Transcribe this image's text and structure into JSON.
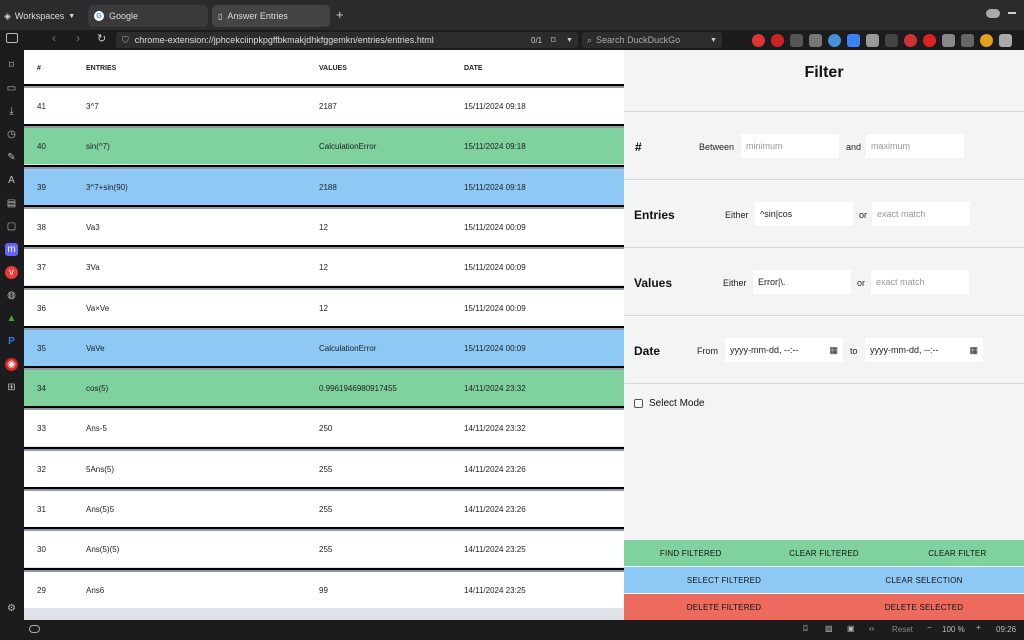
{
  "browser": {
    "workspaces_label": "Workspaces",
    "tabs": [
      {
        "label": "Google"
      },
      {
        "label": "Answer Entries"
      }
    ],
    "url": "chrome-extension://jphcekciinpkpgffbkmakjdhkfggemkn/entries/entries.html",
    "find_count": "0/1",
    "search_placeholder": "Search DuckDuckGo",
    "status": {
      "reset": "Reset",
      "zoom": "100 %",
      "clock": "09:26"
    }
  },
  "table": {
    "headers": {
      "num": "#",
      "entries": "ENTRIES",
      "values": "VALUES",
      "date": "DATE"
    },
    "rows": [
      {
        "num": "41",
        "entry": "3^7",
        "value": "2187",
        "date": "15/11/2024 09:18",
        "color": "#ffffff"
      },
      {
        "num": "40",
        "entry": "sin(^7)",
        "value": "CalculationError",
        "date": "15/11/2024 09:18",
        "color": "#7fd19d"
      },
      {
        "num": "39",
        "entry": "3^7+sin(90)",
        "value": "2188",
        "date": "15/11/2024 09:18",
        "color": "#8ec9f5"
      },
      {
        "num": "38",
        "entry": "Va3",
        "value": "12",
        "date": "15/11/2024 00:09",
        "color": "#ffffff"
      },
      {
        "num": "37",
        "entry": "3Va",
        "value": "12",
        "date": "15/11/2024 00:09",
        "color": "#ffffff"
      },
      {
        "num": "36",
        "entry": "Va×Ve",
        "value": "12",
        "date": "15/11/2024 00:09",
        "color": "#ffffff"
      },
      {
        "num": "35",
        "entry": "VaVe",
        "value": "CalculationError",
        "date": "15/11/2024 00:09",
        "color": "#8ec9f5"
      },
      {
        "num": "34",
        "entry": "cos(5)",
        "value": "0.9961946980917455",
        "date": "14/11/2024 23:32",
        "color": "#7fd19d"
      },
      {
        "num": "33",
        "entry": "Ans-5",
        "value": "250",
        "date": "14/11/2024 23:32",
        "color": "#ffffff"
      },
      {
        "num": "32",
        "entry": "5Ans(5)",
        "value": "255",
        "date": "14/11/2024 23:26",
        "color": "#ffffff"
      },
      {
        "num": "31",
        "entry": "Ans(5)5",
        "value": "255",
        "date": "14/11/2024 23:26",
        "color": "#ffffff"
      },
      {
        "num": "30",
        "entry": "Ans(5)(5)",
        "value": "255",
        "date": "14/11/2024 23:25",
        "color": "#ffffff"
      },
      {
        "num": "29",
        "entry": "Ans6",
        "value": "99",
        "date": "14/11/2024 23:25",
        "color": "#ffffff"
      }
    ]
  },
  "filter": {
    "title": "Filter",
    "num": {
      "label": "#",
      "between": "Between",
      "min_placeholder": "minimum",
      "and": "and",
      "max_placeholder": "maximum"
    },
    "entries": {
      "label": "Entries",
      "either": "Either",
      "regex_value": "^sin|cos",
      "or": "or",
      "exact_placeholder": "exact match"
    },
    "values": {
      "label": "Values",
      "either": "Either",
      "regex_value": "Error|\\.",
      "or": "or",
      "exact_placeholder": "exact match"
    },
    "date": {
      "label": "Date",
      "from": "From",
      "from_placeholder": "yyyy-mm-dd, --:--",
      "to": "to",
      "to_placeholder": "yyyy-mm-dd, --:--"
    },
    "select_mode": "Select Mode",
    "buttons": {
      "find_filtered": "FIND FILTERED",
      "clear_filtered": "CLEAR FILTERED",
      "clear_filter": "CLEAR FILTER",
      "select_filtered": "SELECT FILTERED",
      "clear_selection": "CLEAR SELECTION",
      "delete_filtered": "DELETE FILTERED",
      "delete_selected": "DELETE SELECTED"
    },
    "button_colors": {
      "green": "#7fd19d",
      "blue": "#8ec9f5",
      "red": "#ec6a5e"
    }
  }
}
